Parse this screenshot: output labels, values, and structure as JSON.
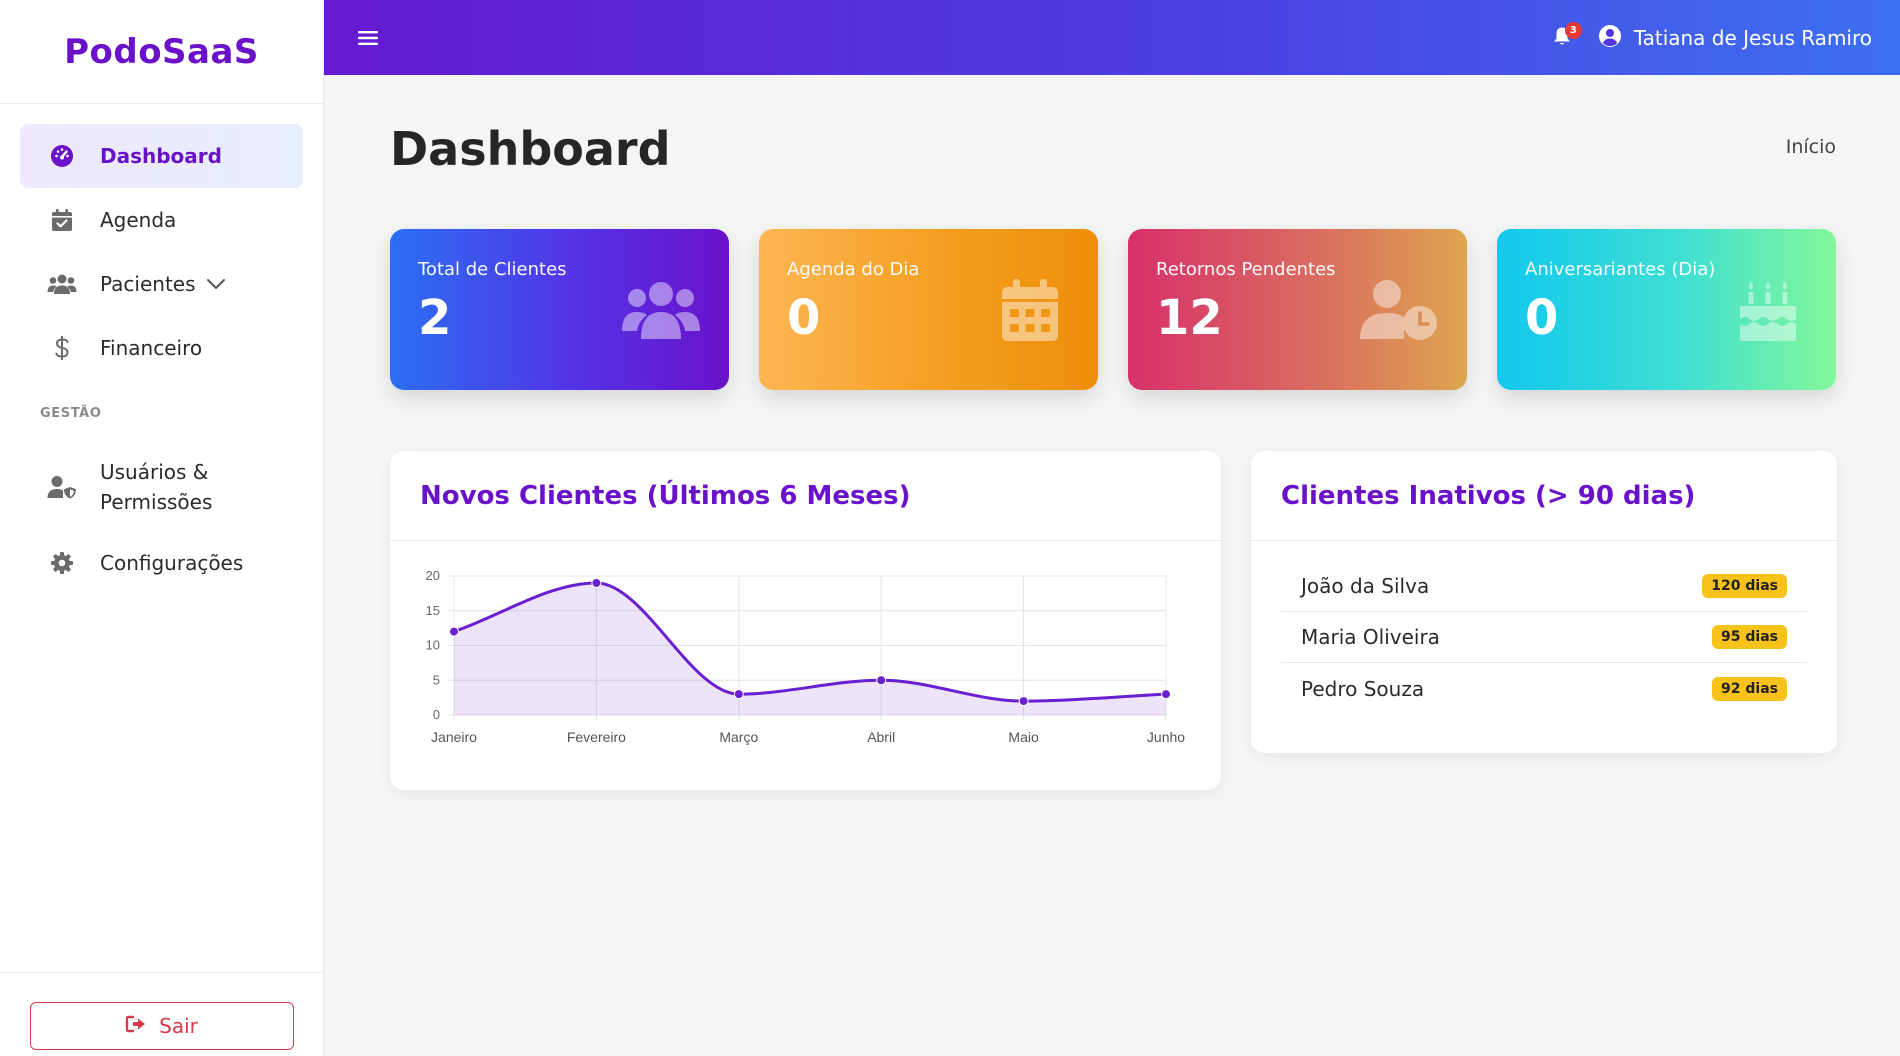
{
  "brand": "PodoSaaS",
  "sidebar": {
    "items": [
      {
        "label": "Dashboard",
        "icon": "gauge-icon",
        "active": true
      },
      {
        "label": "Agenda",
        "icon": "calendar-check-icon"
      },
      {
        "label": "Pacientes",
        "icon": "users-icon",
        "has_submenu": true
      },
      {
        "label": "Financeiro",
        "icon": "dollar-icon"
      }
    ],
    "section_label": "GESTÃO",
    "admin_items": [
      {
        "label": "Usuários & Permissões",
        "icon": "user-shield-icon"
      },
      {
        "label": "Configurações",
        "icon": "gear-icon"
      }
    ],
    "logout_label": "Sair"
  },
  "topbar": {
    "notifications_count": "3",
    "user_name": "Tatiana de Jesus Ramiro"
  },
  "page": {
    "title": "Dashboard",
    "breadcrumb": "Início"
  },
  "cards": [
    {
      "title": "Total de Clientes",
      "value": "2",
      "icon": "users-icon"
    },
    {
      "title": "Agenda do Dia",
      "value": "0",
      "icon": "calendar-icon"
    },
    {
      "title": "Retornos Pendentes",
      "value": "12",
      "icon": "user-clock-icon"
    },
    {
      "title": "Aniversariantes (Dia)",
      "value": "0",
      "icon": "birthday-cake-icon"
    }
  ],
  "new_clients_panel": {
    "title": "Novos Clientes (Últimos 6 Meses)"
  },
  "inactive_panel": {
    "title": "Clientes Inativos (> 90 dias)",
    "rows": [
      {
        "name": "João da Silva",
        "badge": "120 dias"
      },
      {
        "name": "Maria Oliveira",
        "badge": "95 dias"
      },
      {
        "name": "Pedro Souza",
        "badge": "92 dias"
      }
    ]
  },
  "colors": {
    "brand": "#6a12c9",
    "line": "#6a1fd0",
    "badge": "#f7c21a",
    "danger": "#d63b4c"
  },
  "chart_data": {
    "type": "line",
    "categories": [
      "Janeiro",
      "Fevereiro",
      "Março",
      "Abril",
      "Maio",
      "Junho"
    ],
    "values": [
      12,
      19,
      3,
      5,
      2,
      3
    ],
    "ylim": [
      0,
      20
    ],
    "yticks": [
      0,
      5,
      10,
      15,
      20
    ],
    "grid": true,
    "fill": true
  }
}
